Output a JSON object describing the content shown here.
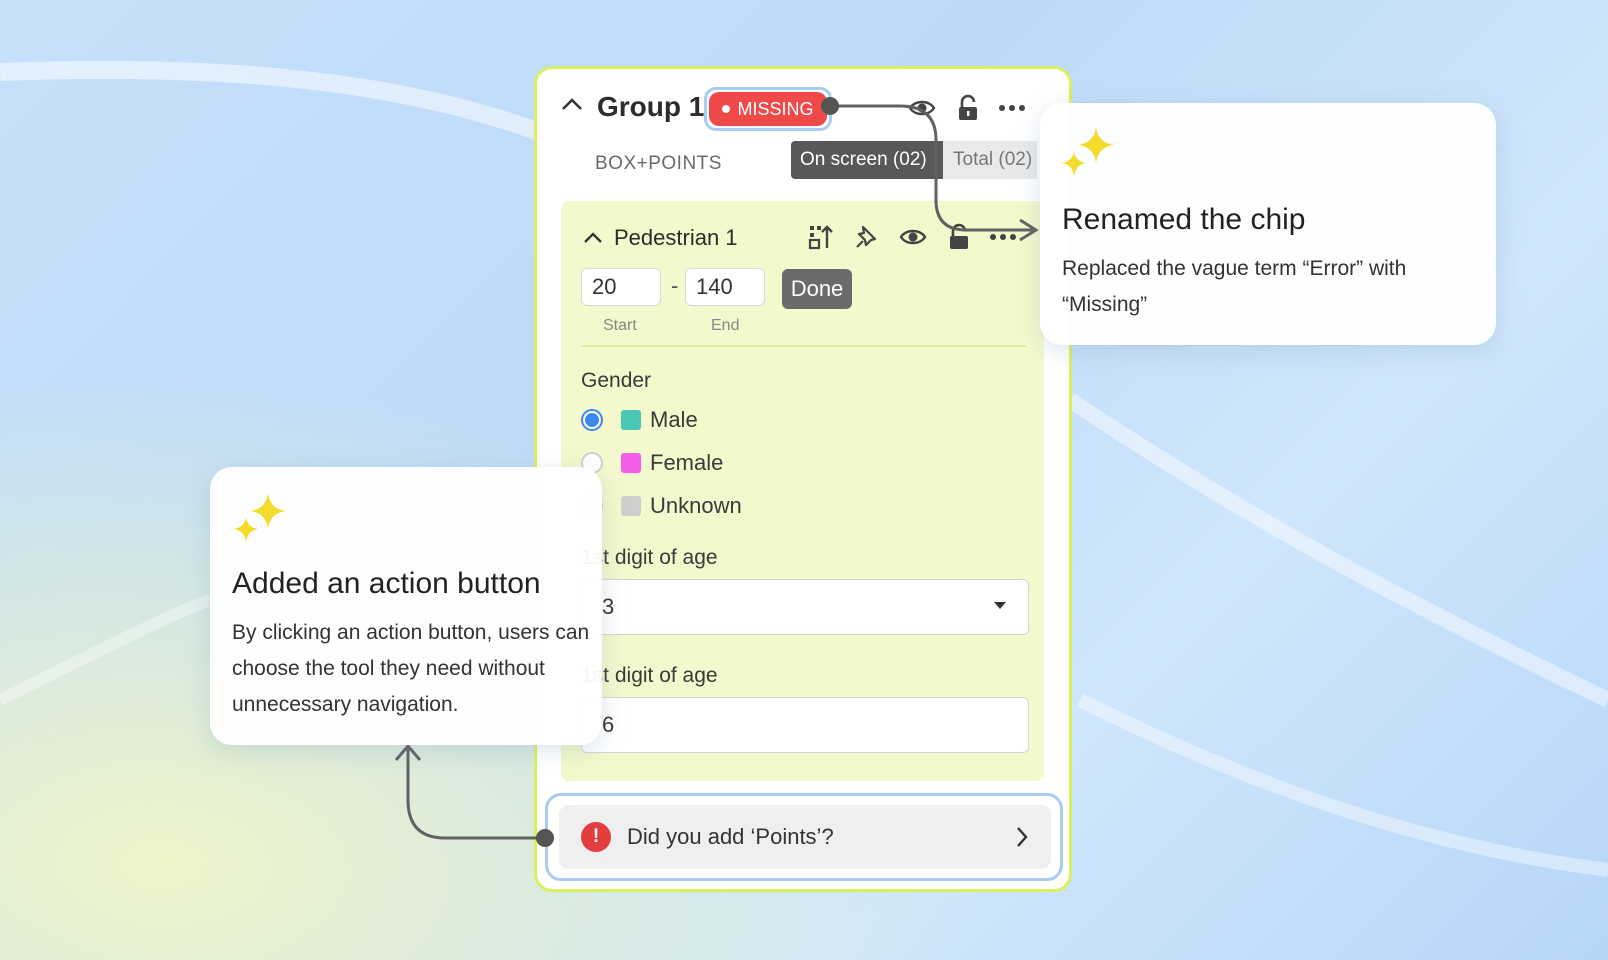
{
  "group": {
    "title": "Group 1",
    "chip_label": "MISSING",
    "subtitle": "BOX+POINTS",
    "tab_on_screen": "On screen (02)",
    "tab_total": "Total (02)"
  },
  "object": {
    "title": "Pedestrian 1",
    "start_value": "20",
    "end_value": "140",
    "done_label": "Done",
    "start_label": "Start",
    "end_label": "End"
  },
  "gender": {
    "label": "Gender",
    "selected": "Male",
    "options": [
      {
        "label": "Male",
        "color": "#49c7b4"
      },
      {
        "label": "Female",
        "color": "#f35ee9"
      },
      {
        "label": "Unknown",
        "color": "#cfcfcf"
      }
    ]
  },
  "age_first": {
    "label": "1st digit of age",
    "value": "3"
  },
  "age_last": {
    "label": "1st digit of age",
    "value": "6"
  },
  "action": {
    "label": "Did you add ‘Points’?"
  },
  "callout_chip": {
    "title": "Renamed the chip",
    "body": "Replaced the vague term “Error” with “Missing”"
  },
  "callout_action": {
    "title": "Added an action button",
    "body": "By clicking an action button, users can choose the tool they need without unnecessary navigation."
  },
  "colors": {
    "panel_border": "#d9f05f",
    "chip_red": "#ee4a4a",
    "selection_ring": "#a9ccf2",
    "radio_blue": "#3e86f0",
    "sparkle_yellow": "#f4dc2c"
  }
}
